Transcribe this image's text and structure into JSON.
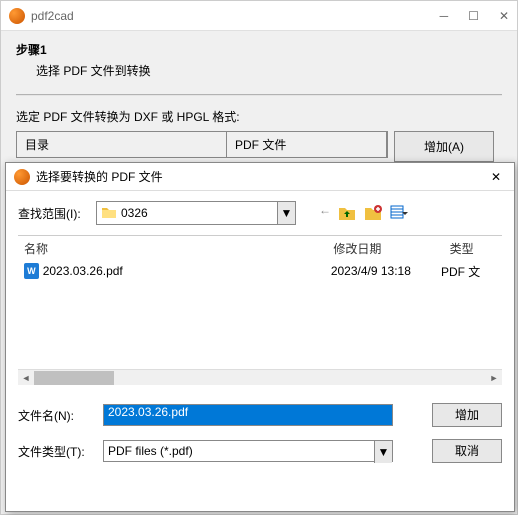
{
  "main": {
    "title": "pdf2cad",
    "step_label": "步骤1",
    "step_desc": "选择 PDF 文件到转换",
    "instruction": "选定 PDF 文件转换为 DXF 或 HPGL 格式:",
    "col_dir": "目录",
    "col_pdf": "PDF 文件",
    "btn_add": "增加(A)"
  },
  "dialog": {
    "title": "选择要转换的 PDF 文件",
    "lookup_label": "查找范围(I):",
    "folder_name": "0326",
    "header_name": "名称",
    "header_date": "修改日期",
    "header_type": "类型",
    "file_name": "2023.03.26.pdf",
    "file_date": "2023/4/9 13:18",
    "file_type": "PDF 文",
    "filename_label": "文件名(N):",
    "filename_value": "2023.03.26.pdf",
    "filetype_label": "文件类型(T):",
    "filetype_value": "PDF files (*.pdf)",
    "btn_add": "增加",
    "btn_cancel": "取消"
  }
}
